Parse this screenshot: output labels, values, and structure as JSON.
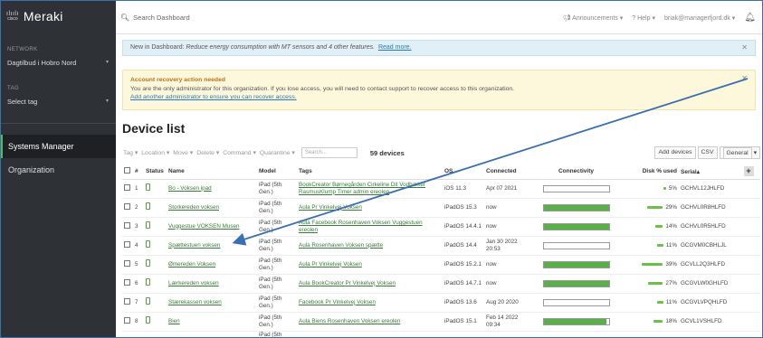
{
  "sidebar": {
    "logo_cisco": "cisco",
    "logo_brand": "Meraki",
    "network_label": "NETWORK",
    "network_value": "Dagtilbud i Hobro Nord",
    "tag_label": "TAG",
    "tag_value": "Select tag",
    "items": [
      {
        "label": "Systems Manager"
      },
      {
        "label": "Organization"
      }
    ]
  },
  "topbar": {
    "search_placeholder": "Search Dashboard",
    "announcements": "Announcements",
    "help": "Help",
    "user": "briak@mariagerfjord.dk"
  },
  "banner_info": {
    "prefix": "New in Dashboard: ",
    "italic": "Reduce energy consumption with MT sensors and 4 other features.",
    "link": "Read more."
  },
  "banner_warn": {
    "title": "Account recovery action needed",
    "text": "You are the only administrator for this organization. If you lose access, you will need to contact support to recover access to this organization.",
    "link": "Add another administrator to ensure you can recover access."
  },
  "page_title": "Device list",
  "toolbar": {
    "tag": "Tag",
    "location": "Location",
    "move": "Move",
    "delete": "Delete",
    "command": "Command",
    "quarantine": "Quarantine",
    "search_placeholder": "Search...",
    "count": "59 devices",
    "add_devices": "Add devices",
    "csv": "CSV",
    "general": "General"
  },
  "table": {
    "headers": {
      "num": "#",
      "status": "Status",
      "name": "Name",
      "model": "Model",
      "tags": "Tags",
      "os": "OS",
      "connected": "Connected",
      "connectivity": "Connectivity",
      "disk": "Disk % used",
      "serial": "Serial"
    },
    "rows": [
      {
        "num": "1",
        "name": "Bo - Voksen ipad",
        "model": "iPad (5th Gen.)",
        "tags": "BookCreator Børnegården Cirkeline Dit Vodbæker RasmusKlump Timer admin ereolen",
        "os": "iOS 11.3",
        "connected": "Apr 07 2021",
        "conn": 0.0,
        "disk": "5%",
        "serial": "GCHVL12JHLFD"
      },
      {
        "num": "2",
        "name": "Storkereden voksen",
        "model": "iPad (5th Gen.)",
        "tags": "Aula Pr Vinkelvej Voksen",
        "os": "iPadOS 15.3",
        "connected": "now",
        "conn": 1.0,
        "disk": "29%",
        "serial": "GCHVL0R8HLFD"
      },
      {
        "num": "3",
        "name": "Vuggestue VOKSEN Musen",
        "model": "iPad (5th Gen.)",
        "tags": "Aula Facebook Rosenhaven Voksen Vuggestuen ereolen",
        "os": "iPadOS 14.4.1",
        "connected": "now",
        "conn": 1.0,
        "disk": "14%",
        "serial": "GCHVL0R5HLFD"
      },
      {
        "num": "4",
        "name": "Spættestuen voksen",
        "model": "iPad (5th Gen.)",
        "tags": "Aula Rosenhaven Voksen spætte",
        "os": "iPadOS 14.4",
        "connected": "Jan 30 2022 20:53",
        "conn": 0.0,
        "disk": "11%",
        "serial": "GCGVM0CBHLJL"
      },
      {
        "num": "5",
        "name": "Ømereden Voksen",
        "model": "iPad (5th Gen.)",
        "tags": "Aula Pr Vinkelvej Voksen",
        "os": "iPadOS 15.2.1",
        "connected": "now",
        "conn": 1.0,
        "disk": "39%",
        "serial": "GCVLL2Q3HLFD"
      },
      {
        "num": "6",
        "name": "Lærkereden voksen",
        "model": "iPad (5th Gen.)",
        "tags": "Aula BookCreator Pr Vinkelvej Voksen",
        "os": "iPadOS 14.7.1",
        "connected": "now",
        "conn": 1.0,
        "disk": "27%",
        "serial": "GCGVLW0GHLFD"
      },
      {
        "num": "7",
        "name": "Stærekassen voksen",
        "model": "iPad (5th Gen.)",
        "tags": "Facebook Pr Vinkelvej Voksen",
        "os": "iPadOS 13.6",
        "connected": "Aug 20 2020",
        "conn": 0.0,
        "disk": "11%",
        "serial": "GCGVLVPQHLFD"
      },
      {
        "num": "8",
        "name": "Bien",
        "model": "iPad (5th Gen.)",
        "tags": "Aula Biens Rosenhaven Voksen ereolen",
        "os": "iPadOS 15.1",
        "connected": "Feb 14 2022 09:34",
        "conn": 0.97,
        "disk": "18%",
        "serial": "GCVL1VSHLFD"
      }
    ],
    "partial_row_model": "iPad (5th"
  },
  "colors": {
    "sidebar_bg": "#2e3136",
    "accent_green": "#58b047",
    "annotation_blue": "#3a6fb0"
  }
}
